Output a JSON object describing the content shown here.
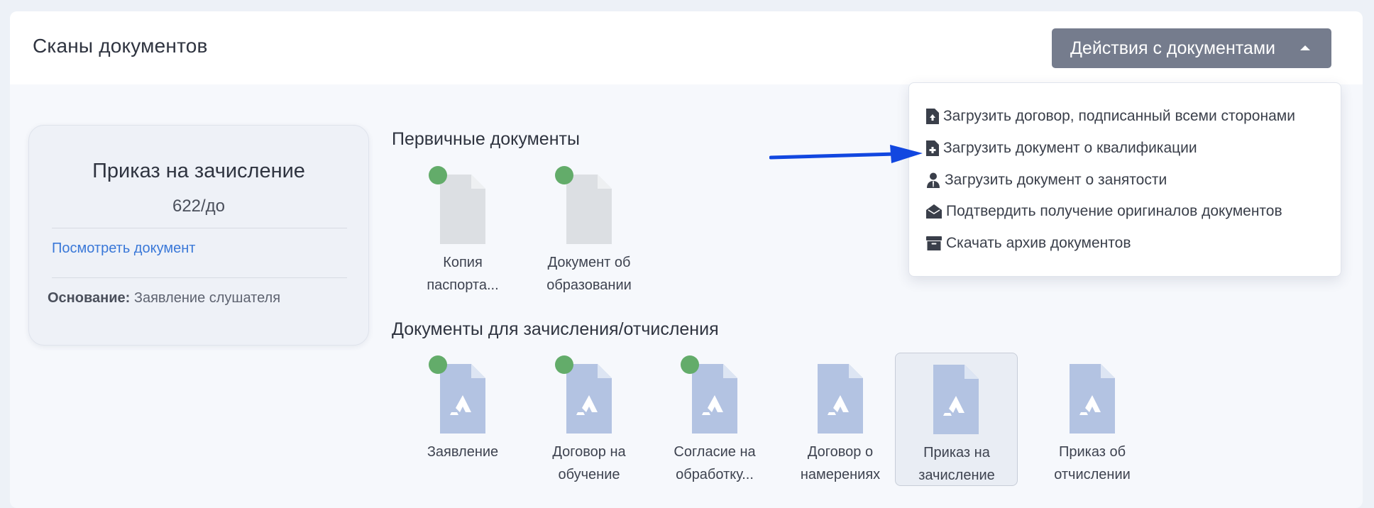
{
  "header": {
    "title": "Сканы документов",
    "actions_label": "Действия с документами"
  },
  "dropdown": {
    "items": [
      {
        "label": "Загрузить договор, подписанный всеми сторонами",
        "icon": "file-upload-icon"
      },
      {
        "label": "Загрузить документ о квалификации",
        "icon": "file-plus-icon"
      },
      {
        "label": "Загрузить документ о занятости",
        "icon": "user-tie-icon"
      },
      {
        "label": "Подтвердить получение оригиналов документов",
        "icon": "envelope-open-icon"
      },
      {
        "label": "Скачать архив документов",
        "icon": "archive-icon"
      }
    ]
  },
  "order_card": {
    "title": "Приказ на зачисление",
    "number": "622/до",
    "view_link": "Посмотреть документ",
    "basis_label": "Основание:",
    "basis_value": "Заявление слушателя"
  },
  "primary_docs": {
    "title": "Первичные документы",
    "items": [
      {
        "label_line1": "Копия",
        "label_line2": "паспорта...",
        "uploaded": true,
        "type": "blank"
      },
      {
        "label_line1": "Документ об",
        "label_line2": "образовании",
        "uploaded": true,
        "type": "blank"
      }
    ]
  },
  "enroll_docs": {
    "title": "Документы для зачисления/отчисления",
    "items": [
      {
        "label_line1": "Заявление",
        "label_line2": "",
        "uploaded": true,
        "type": "pdf"
      },
      {
        "label_line1": "Договор на",
        "label_line2": "обучение",
        "uploaded": true,
        "type": "pdf"
      },
      {
        "label_line1": "Согласие на",
        "label_line2": "обработку...",
        "uploaded": true,
        "type": "pdf"
      },
      {
        "label_line1": "Договор о",
        "label_line2": "намерениях",
        "uploaded": false,
        "type": "pdf"
      },
      {
        "label_line1": "Приказ на",
        "label_line2": "зачисление",
        "uploaded": false,
        "type": "pdf",
        "selected": true
      },
      {
        "label_line1": "Приказ об",
        "label_line2": "отчислении",
        "uploaded": false,
        "type": "pdf"
      }
    ]
  },
  "colors": {
    "accent": "#3a78d8",
    "button": "#757c8d",
    "status_ok": "#63ac6a",
    "pdf_icon": "#b3c3e2",
    "blank_icon": "#dcdfe3",
    "arrow": "#1247e0"
  }
}
